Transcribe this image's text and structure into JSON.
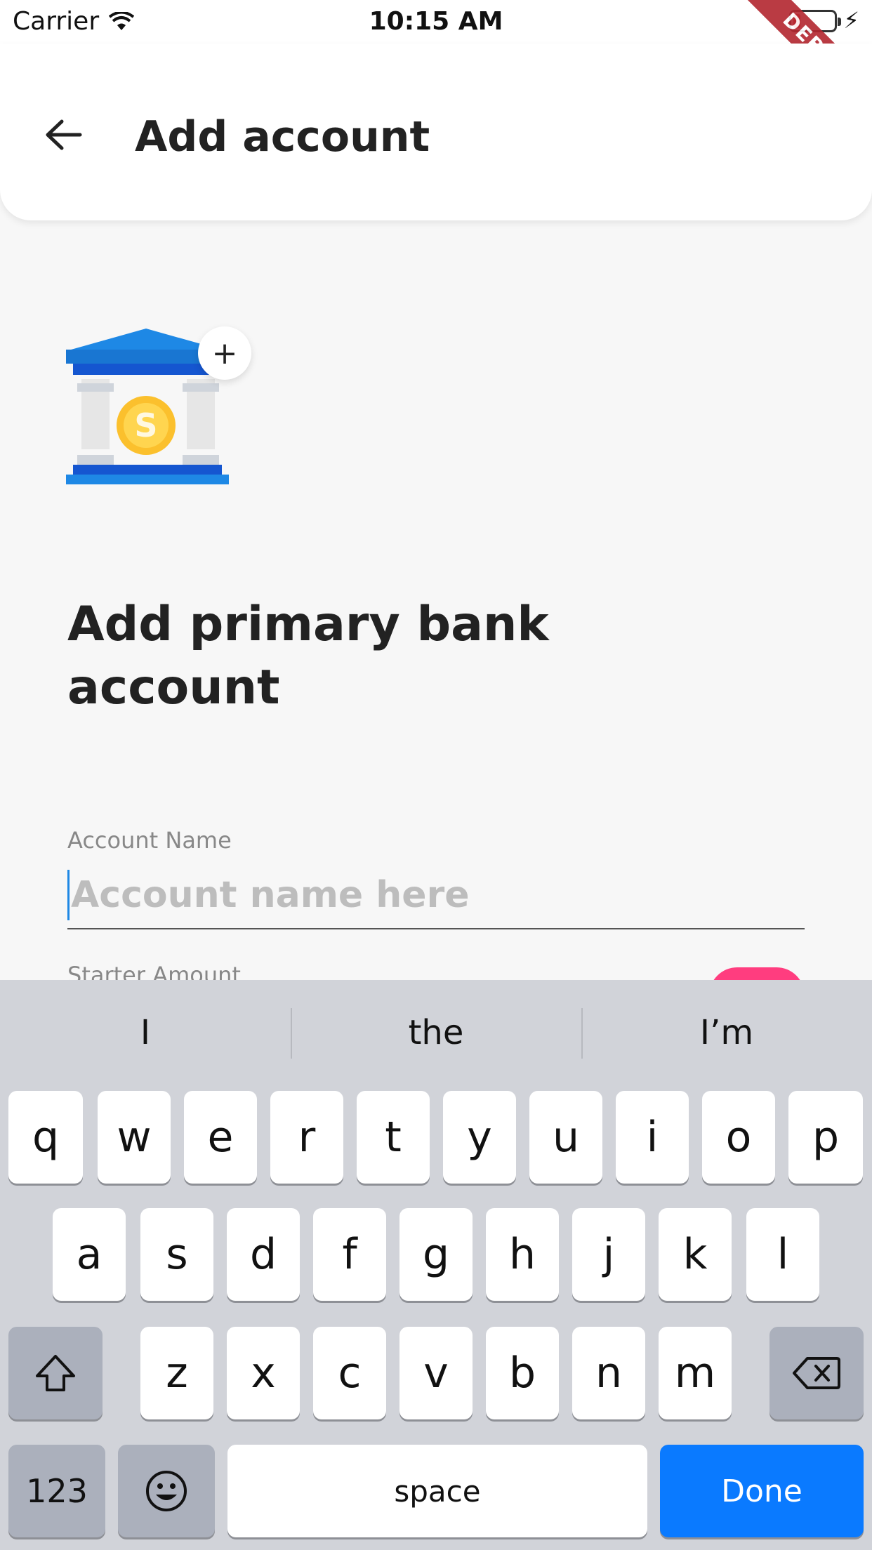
{
  "status_bar": {
    "carrier": "Carrier",
    "time": "10:15 AM",
    "icons": [
      "wifi-icon",
      "battery-icon",
      "charging-bolt-icon"
    ]
  },
  "debug_banner": "DEBUG",
  "app_bar": {
    "back_icon": "arrow-left-icon",
    "title": "Add account"
  },
  "illustration": {
    "name": "bank-building-with-coin",
    "badge_icon": "plus-icon",
    "badge_text": "+",
    "colors": {
      "roof": "#1e88e5",
      "coin": "#fbc02d",
      "pillars": "#e0e0e0"
    }
  },
  "main": {
    "heading_line1": "Add primary bank",
    "heading_line2": "account",
    "account_name_label": "Account Name",
    "account_name_placeholder": "Account name here",
    "starter_amount_label": "Starter Amount"
  },
  "keyboard": {
    "suggestions": [
      "I",
      "the",
      "I’m"
    ],
    "row1": [
      "q",
      "w",
      "e",
      "r",
      "t",
      "y",
      "u",
      "i",
      "o",
      "p"
    ],
    "row2": [
      "a",
      "s",
      "d",
      "f",
      "g",
      "h",
      "j",
      "k",
      "l"
    ],
    "row3": [
      "z",
      "x",
      "c",
      "v",
      "b",
      "n",
      "m"
    ],
    "shift_icon": "shift-icon",
    "delete_icon": "backspace-icon",
    "numbers_label": "123",
    "emoji_icon": "emoji-icon",
    "space_label": "space",
    "done_label": "Done"
  },
  "colors": {
    "accent": "#0a7aff",
    "pink": "#ff3d7f",
    "background": "#f7f7f7"
  }
}
